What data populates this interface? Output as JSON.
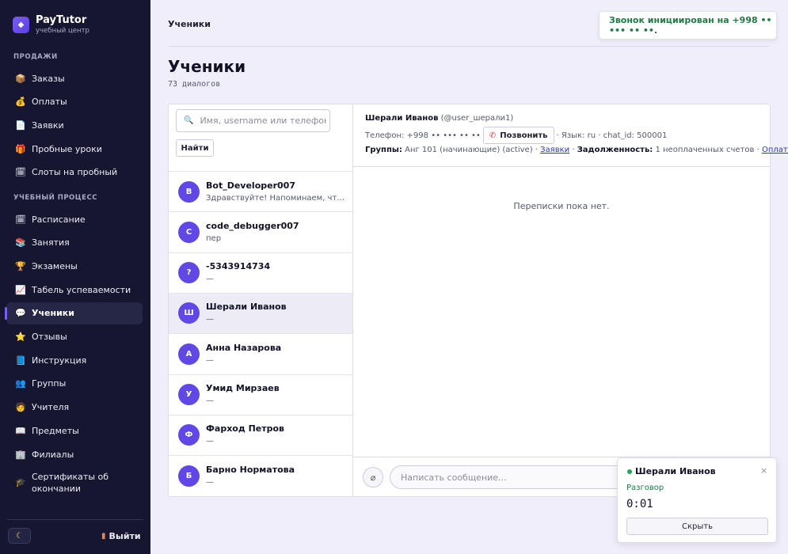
{
  "brand": {
    "title": "PayTutor",
    "subtitle": "учебный центр",
    "logo_icon": "logo-icon"
  },
  "sidebar": {
    "sections": [
      {
        "label": "ПРОДАЖИ"
      },
      {
        "label": "УЧЕБНЫЙ ПРОЦЕСС"
      }
    ],
    "sales_items": [
      {
        "label": "Заказы",
        "icon": "box-icon",
        "glyph": "📦"
      },
      {
        "label": "Оплаты",
        "icon": "money-bag-icon",
        "glyph": "💰"
      },
      {
        "label": "Заявки",
        "icon": "document-icon",
        "glyph": "📄"
      },
      {
        "label": "Пробные уроки",
        "icon": "gift-icon",
        "glyph": "🎁"
      },
      {
        "label": "Слоты на пробный",
        "icon": "calendar-icon",
        "glyph": "🗓"
      }
    ],
    "study_items": [
      {
        "label": "Расписание",
        "icon": "calendar-icon",
        "glyph": "🗓"
      },
      {
        "label": "Занятия",
        "icon": "books-icon",
        "glyph": "📚"
      },
      {
        "label": "Экзамены",
        "icon": "trophy-icon",
        "glyph": "🏆"
      },
      {
        "label": "Табель успеваемости",
        "icon": "chart-icon",
        "glyph": "📈"
      },
      {
        "label": "Ученики",
        "icon": "speech-bubble-icon",
        "glyph": "💬",
        "active": true
      },
      {
        "label": "Отзывы",
        "icon": "star-icon",
        "glyph": "⭐"
      },
      {
        "label": "Инструкция",
        "icon": "book-icon",
        "glyph": "📘"
      },
      {
        "label": "Группы",
        "icon": "people-icon",
        "glyph": "👥"
      },
      {
        "label": "Учителя",
        "icon": "teacher-icon",
        "glyph": "🧑"
      },
      {
        "label": "Предметы",
        "icon": "open-book-icon",
        "glyph": "📖"
      },
      {
        "label": "Филиалы",
        "icon": "building-icon",
        "glyph": "🏢"
      },
      {
        "label": "Сертификаты об окончании",
        "icon": "graduation-cap-icon",
        "glyph": "🎓"
      }
    ],
    "theme_icon": "moon-icon",
    "logout_label": "Выйти",
    "logout_icon": "door-icon"
  },
  "header": {
    "breadcrumb": "Ученики"
  },
  "page": {
    "title": "Ученики",
    "subtitle": "73 диалогов"
  },
  "toast": {
    "text": "Звонок инициирован на +998 •• ••• •• ••."
  },
  "search": {
    "placeholder": "Имя, username или телефон",
    "value": "",
    "button": "Найти"
  },
  "contacts": [
    {
      "initial": "B",
      "name": "Bot_Developer007",
      "last": "Здравствуйте! Напоминаем, что занятие"
    },
    {
      "initial": "C",
      "name": "code_debugger007",
      "last": "пер"
    },
    {
      "initial": "?",
      "name": "-5343914734",
      "last": "—"
    },
    {
      "initial": "Ш",
      "name": "Шерали Иванов",
      "last": "—",
      "active": true
    },
    {
      "initial": "А",
      "name": "Анна Назарова",
      "last": "—"
    },
    {
      "initial": "У",
      "name": "Умид Мирзаев",
      "last": "—"
    },
    {
      "initial": "Ф",
      "name": "Фарход Петров",
      "last": "—"
    },
    {
      "initial": "Б",
      "name": "Барно Норматова",
      "last": "—"
    }
  ],
  "chat": {
    "name": "Шерали Иванов",
    "username": "(@user_шерали1)",
    "phone_label": "Телефон: +998 •• ••• •• ••",
    "call_button": "Позвонить",
    "meta": "· Язык: ru · chat_id: 500001",
    "groups_label": "Группы:",
    "groups_value": "Анг 101 (начинающие) (active) ·",
    "requests_link": "Заявки",
    "debt_label": "Задолженность:",
    "debt_value": "1 неоплаченных счетов ·",
    "payments_link": "Оплаты",
    "empty_text": "Переписки пока нет.",
    "input_placeholder": "Написать сообщение..."
  },
  "call_widget": {
    "name": "Шерали Иванов",
    "status": "Разговор",
    "timer": "0:01",
    "hide_button": "Скрыть",
    "close_glyph": "×"
  },
  "colors": {
    "sidebar_bg": "#161630",
    "accent": "#6047e6",
    "success": "#1f7a46",
    "page_bg": "#f1eefb"
  }
}
